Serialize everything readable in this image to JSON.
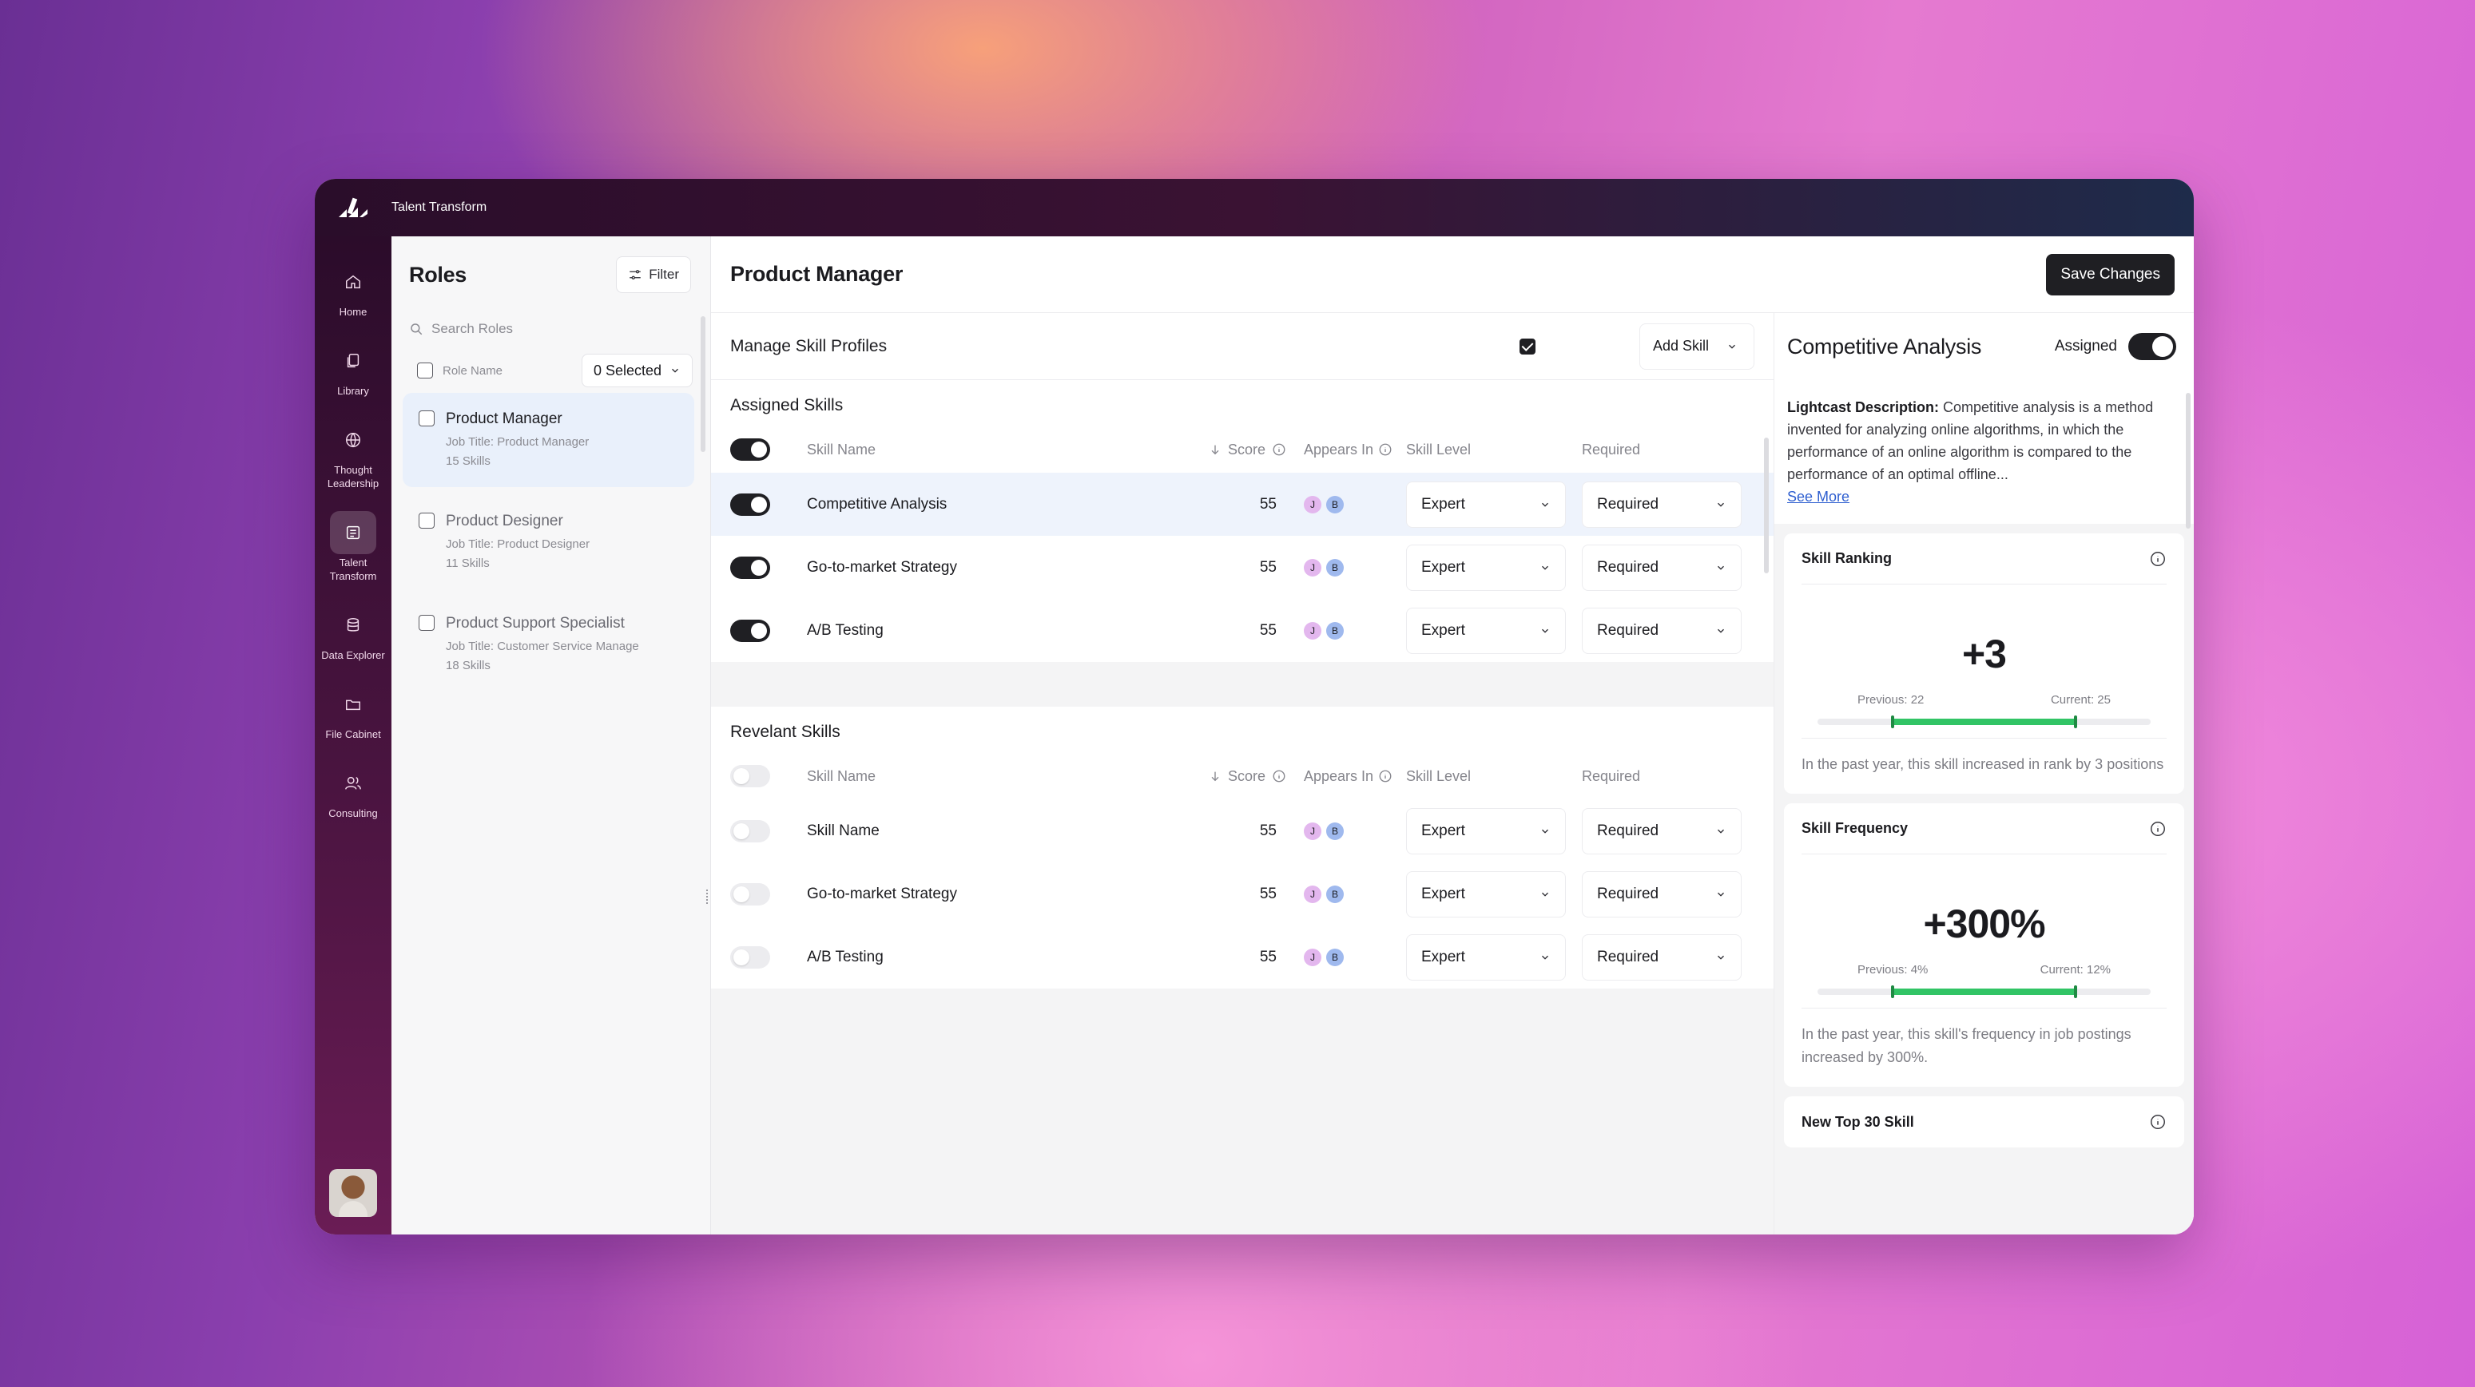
{
  "app": {
    "title": "Talent Transform"
  },
  "rail": {
    "items": [
      {
        "label": "Home",
        "icon": "home-icon"
      },
      {
        "label": "Library",
        "icon": "library-icon"
      },
      {
        "label": "Thought Leadership",
        "icon": "globe-icon"
      },
      {
        "label": "Talent Transform",
        "icon": "list-icon",
        "active": true
      },
      {
        "label": "Data Explorer",
        "icon": "database-icon"
      },
      {
        "label": "File Cabinet",
        "icon": "folder-icon"
      },
      {
        "label": "Consulting",
        "icon": "users-icon"
      }
    ]
  },
  "roles": {
    "title": "Roles",
    "filter_label": "Filter",
    "search_placeholder": "Search Roles",
    "column_label": "Role Name",
    "selected_label": "0 Selected",
    "items": [
      {
        "name": "Product Manager",
        "job": "Job Title: Product Manager",
        "skills": "15 Skills",
        "active": true
      },
      {
        "name": "Product Designer",
        "job": "Job Title: Product Designer",
        "skills": "11 Skills"
      },
      {
        "name": "Product Support Specialist",
        "job": "Job Title: Customer Service Manage",
        "skills": "18 Skills"
      }
    ]
  },
  "main": {
    "title": "Product Manager",
    "save_label": "Save Changes",
    "manage_title": "Manage Skill Profiles",
    "add_skill_label": "Add Skill",
    "headers": {
      "name": "Skill Name",
      "score": "Score",
      "appears": "Appears In",
      "level": "Skill Level",
      "required": "Required"
    },
    "assigned": {
      "title": "Assigned Skills",
      "rows": [
        {
          "name": "Competitive Analysis",
          "score": "55",
          "badges": [
            "J",
            "B"
          ],
          "level": "Expert",
          "required": "Required",
          "on": true
        },
        {
          "name": "Go-to-market Strategy",
          "score": "55",
          "badges": [
            "J",
            "B"
          ],
          "level": "Expert",
          "required": "Required",
          "on": true
        },
        {
          "name": "A/B Testing",
          "score": "55",
          "badges": [
            "J",
            "B"
          ],
          "level": "Expert",
          "required": "Required",
          "on": true
        }
      ]
    },
    "relevant": {
      "title": "Revelant Skills",
      "rows": [
        {
          "name": "Skill Name",
          "score": "55",
          "badges": [
            "J",
            "B"
          ],
          "level": "Expert",
          "required": "Required",
          "on": false
        },
        {
          "name": "Go-to-market Strategy",
          "score": "55",
          "badges": [
            "J",
            "B"
          ],
          "level": "Expert",
          "required": "Required",
          "on": false
        },
        {
          "name": "A/B Testing",
          "score": "55",
          "badges": [
            "J",
            "B"
          ],
          "level": "Expert",
          "required": "Required",
          "on": false
        }
      ]
    }
  },
  "detail": {
    "title": "Competitive Analysis",
    "assigned_label": "Assigned",
    "desc_label": "Lightcast Description:",
    "desc_text": " Competitive analysis is a method invented for analyzing online algorithms, in which the performance of an online algorithm is compared to the performance of an optimal offline...",
    "see_more": "See More",
    "cards": [
      {
        "title": "Skill Ranking",
        "value": "+3",
        "previous": "Previous: 22",
        "current": "Current: 25",
        "note": "In the past year, this skill increased in rank by 3 positions"
      },
      {
        "title": "Skill Frequency",
        "value": "+300%",
        "previous": "Previous: 4%",
        "current": "Current: 12%",
        "note": "In the past year, this skill's frequency in job postings increased by 300%."
      },
      {
        "title": "New Top 30 Skill"
      }
    ]
  },
  "colors": {
    "accent_green": "#31c465",
    "dark": "#1f1f23",
    "highlight_row": "#eef3fc"
  }
}
